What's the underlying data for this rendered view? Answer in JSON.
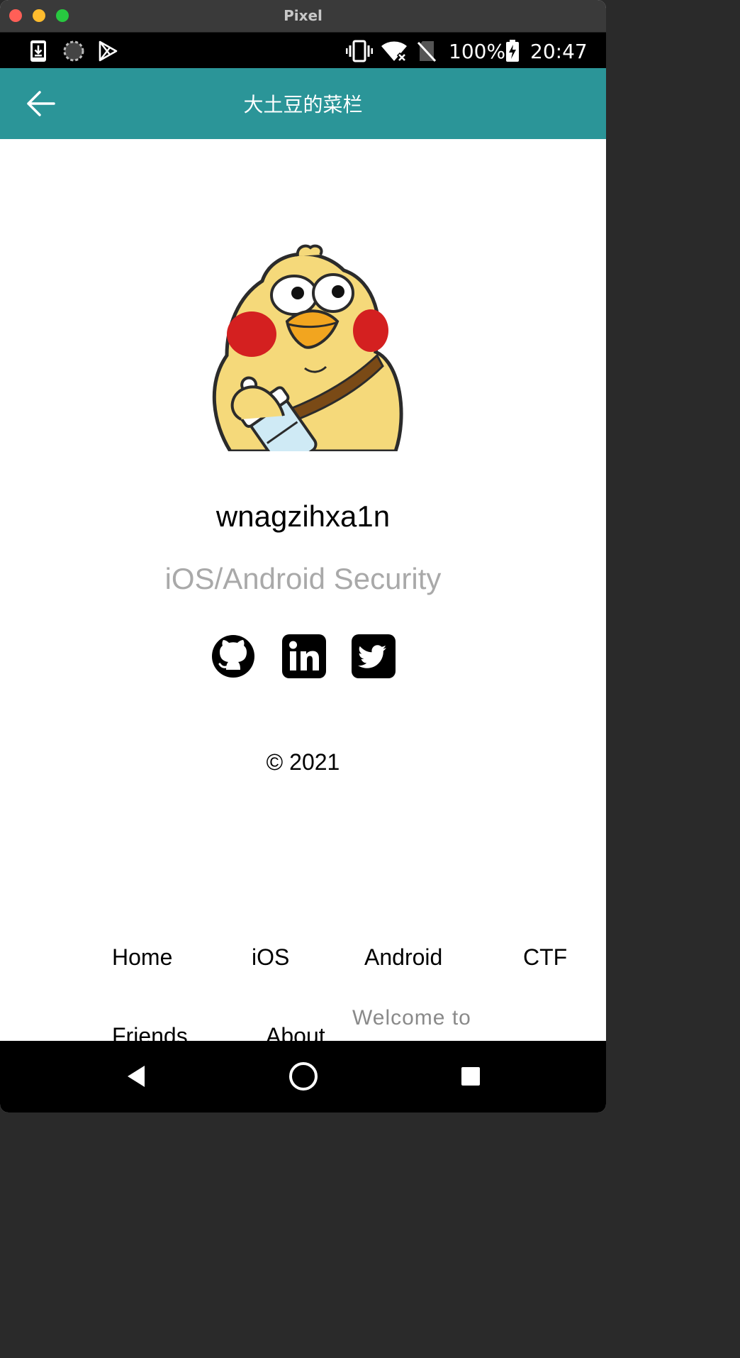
{
  "window": {
    "title": "Pixel"
  },
  "status_bar": {
    "battery": "100%",
    "time": "20:47",
    "icons": [
      "download-icon",
      "sync-icon",
      "play-store-icon",
      "vibrate-icon",
      "wifi-off-icon",
      "no-sim-icon",
      "battery-charging-icon"
    ]
  },
  "app_bar": {
    "title": "大土豆的菜栏",
    "back_icon": "arrow-left-icon"
  },
  "profile": {
    "name": "wnagzihxa1n",
    "subtitle": "iOS/Android Security",
    "avatar": "yellow-chick-with-baby-bottle"
  },
  "social": [
    {
      "name": "github",
      "icon": "github-icon"
    },
    {
      "name": "linkedin",
      "icon": "linkedin-icon"
    },
    {
      "name": "twitter",
      "icon": "twitter-icon"
    }
  ],
  "footer": {
    "copyright": "© 2021"
  },
  "nav": {
    "items": [
      {
        "label": "Home"
      },
      {
        "label": "iOS"
      },
      {
        "label": "Android"
      },
      {
        "label": "CTF"
      },
      {
        "label": "Friends"
      },
      {
        "label": "About"
      }
    ],
    "welcome": "Welcome to"
  },
  "colors": {
    "app_bar": "#2b9598",
    "subtitle": "#a9a9a9",
    "welcome": "#8a8a8a"
  }
}
